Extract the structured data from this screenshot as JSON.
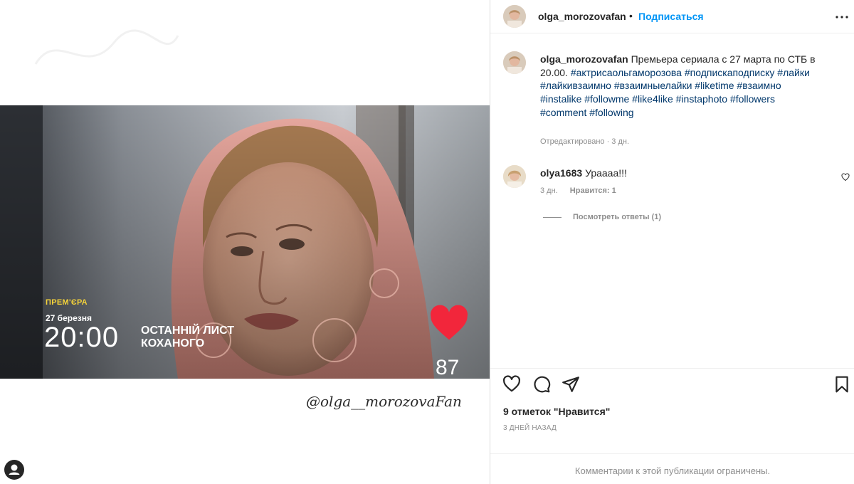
{
  "post": {
    "username": "olga_morozovafan",
    "header_separator": "•",
    "follow_label": "Подписаться",
    "caption_text": "Премьера сериала с 27 марта по СТБ в 20.00.",
    "hashtags": "#актрисаольгаморозова #подпискаподписку #лайки #лайкивзаимно #взаимныелайки #liketime #взаимно #instalike #followme #like4like #instaphoto #followers #comment #following",
    "caption_meta": "Отредактировано · 3 дн.",
    "likes_text": "9 отметок \"Нравится\"",
    "age_text": "3 ДНЕЙ НАЗАД",
    "comments_restricted": "Комментарии к этой публикации ограничены."
  },
  "comment": {
    "username": "olya1683",
    "text": "Урaaaa!!!",
    "age": "3 дн.",
    "likes": "Нравится: 1",
    "view_replies": "Посмотреть ответы (1)"
  },
  "media": {
    "premiere_label": "ПРЕМ'ЄРА",
    "premiere_date": "27 березня",
    "premiere_time": "20:00",
    "show_title_line1": "ОСТАННІЙ ЛИСТ",
    "show_title_line2": "КОХАНОГО",
    "heart_count": "87",
    "signature": "@olga__morozovaFan"
  },
  "icons": {
    "more": "more-horizontal-icon",
    "like": "heart-outline-icon",
    "comment": "comment-bubble-icon",
    "share": "paper-plane-icon",
    "save": "bookmark-icon",
    "user": "user-icon"
  },
  "colors": {
    "follow": "#0095f6",
    "hashtag": "#00376b",
    "muted": "#8e8e8e",
    "heart": "#f2263b"
  }
}
